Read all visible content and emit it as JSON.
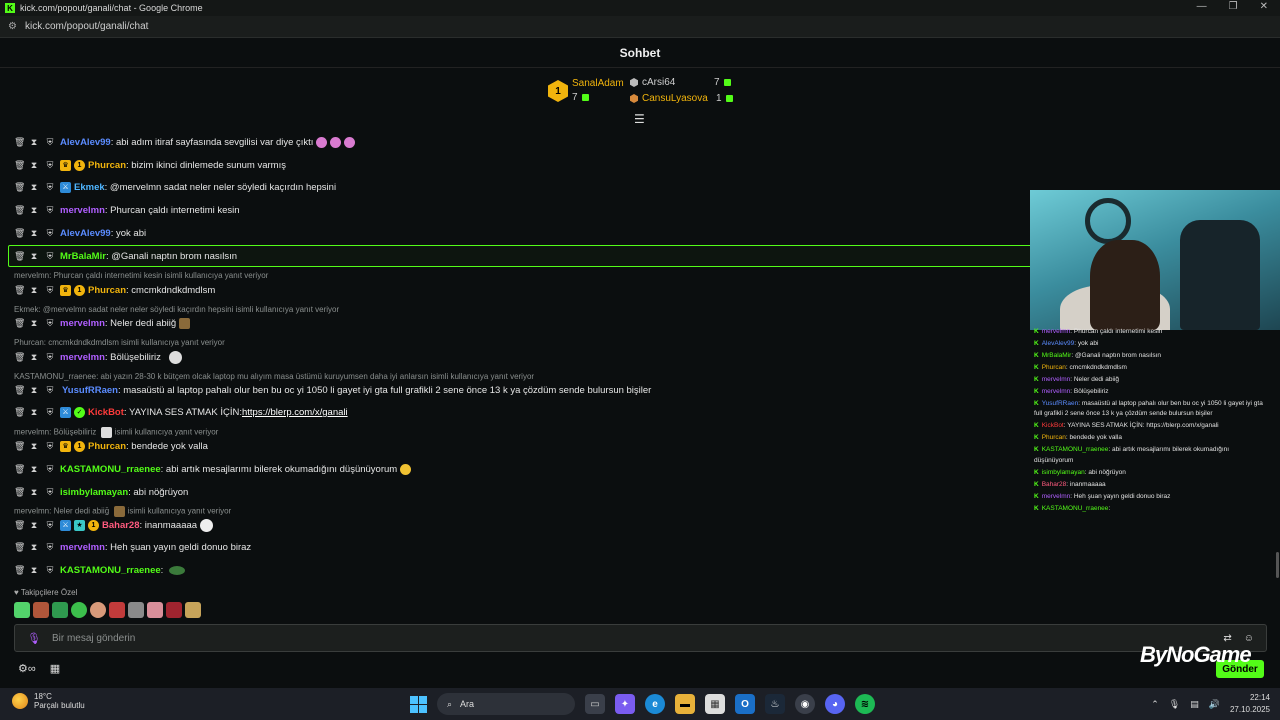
{
  "browser": {
    "window_title": "kick.com/popout/ganali/chat - Google Chrome",
    "url": "kick.com/popout/ganali/chat",
    "controls": [
      "—",
      "❐",
      "✕"
    ]
  },
  "chat": {
    "title": "Sohbet",
    "leaderboard": {
      "first": {
        "rank": "1",
        "name": "SanalAdam",
        "count": "7"
      },
      "second": {
        "name": "cArsi64",
        "count": "7"
      },
      "third": {
        "name": "CansuLyasova",
        "count": "1"
      }
    },
    "messages": [
      {
        "user": "AlevAlev99",
        "color": "#5b8cff",
        "text": ": abi adım itiraf sayfasında sevgilisi var diye çıktı"
      },
      {
        "user": "Phurcan",
        "color": "#f1b40d",
        "text": ": bizim ikinci dinlemede sunum varmış"
      },
      {
        "user": "Ekmek",
        "color": "#4fb5ff",
        "text": ": @mervelmn sadat neler neler söyledi kaçırdın hepsini"
      },
      {
        "user": "mervelmn",
        "color": "#b05fff",
        "text": ": Phurcan çaldı internetimi kesin"
      },
      {
        "user": "AlevAlev99",
        "color": "#5b8cff",
        "text": ": yok abi"
      },
      {
        "user": "MrBalaMir",
        "color": "#53fc18",
        "text": ": @Ganali naptın brom nasılsın"
      },
      {
        "user": "Phurcan",
        "color": "#f1b40d",
        "text": ": cmcmkdndkdmdlsm"
      },
      {
        "user": "mervelmn",
        "color": "#b05fff",
        "text": ": Neler dedi abiiğ"
      },
      {
        "user": "mervelmn",
        "color": "#b05fff",
        "text": ": Bölüşebiliriz"
      },
      {
        "user": "YusufRRaen",
        "color": "#5b8cff",
        "text": ": masaüstü al laptop pahalı olur ben bu oc yi 1050 li gayet iyi gta full grafikli 2 sene önce 13 k ya çözdüm sende bulursun bişiler"
      },
      {
        "user": "KickBot",
        "color": "#ff3b3b",
        "text": ": YAYINA SES ATMAK İÇİN: ",
        "link": "https://blerp.com/x/ganali"
      },
      {
        "user": "Phurcan",
        "color": "#f1b40d",
        "text": ": bendede yok valla"
      },
      {
        "user": "KASTAMONU_rraenee",
        "color": "#53fc18",
        "text": ": abi artık mesajlarımı bilerek okumadığını düşünüyorum"
      },
      {
        "user": "isimbylamayan",
        "color": "#53fc18",
        "text": ": abi nöğrüyon"
      },
      {
        "user": "Bahar28",
        "color": "#ff5b7f",
        "text": ": inanmaaaaa"
      },
      {
        "user": "mervelmn",
        "color": "#b05fff",
        "text": ": Heh şuan yayın geldi donuo biraz"
      },
      {
        "user": "KASTAMONU_rraenee",
        "color": "#53fc18",
        "text": ":"
      }
    ],
    "replies": [
      "mervelmn: Phurcan çaldı internetimi kesin isimli kullanıcıya yanıt veriyor",
      "Ekmek: @mervelmn sadat neler neler söyledi kaçırdın hepsini isimli kullanıcıya yanıt veriyor",
      "Phurcan: cmcmkdndkdmdlsm isimli kullanıcıya yanıt veriyor",
      "KASTAMONU_rraenee: abi yazın 28-30 k bütçem olcak laptop mu alıyım masa üstümü kuruyumsen daha iyi anlarsın isimli kullanıcıya yanıt veriyor",
      "mervelmn: Bölüşebiliriz",
      "isimli kullanıcıya yanıt veriyor",
      "mervelmn: Neler dedi abiiğ",
      "isimli kullanıcıya yanıt veriyor"
    ],
    "followers_label": "Takipçilere Özel",
    "input_placeholder": "Bir mesaj gönderin",
    "send_label": "Gönder"
  },
  "overlay": {
    "watermark": "ByNoGame",
    "mini_chat": [
      {
        "user": "mervelmn",
        "text": ": Phurcan çaldı internetimi kesin"
      },
      {
        "user": "AlevAlev99",
        "text": ": yok abi"
      },
      {
        "user": "MrBalaMir",
        "text": ": @Ganali naptın brom nasılsın"
      },
      {
        "user": "Phurcan",
        "text": ": cmcmkdndkdmdlsm"
      },
      {
        "user": "mervelmn",
        "text": ": Neler dedi abiiğ"
      },
      {
        "user": "mervelmn",
        "text": ": Bölüşebiliriz"
      },
      {
        "user": "YusufRRaen",
        "text": ": masaüstü al laptop pahalı olur ben bu oc yi 1050 li gayet iyi gta"
      },
      {
        "user": "",
        "text": "full grafikli 2 sene önce 13 k ya çözdüm sende bulursun bişiler"
      },
      {
        "user": "KickBot",
        "text": ": YAYINA SES ATMAK İÇİN: https://blerp.com/x/ganali"
      },
      {
        "user": "Phurcan",
        "text": ": bendede yok valla"
      },
      {
        "user": "KASTAMONU_rraenee",
        "text": ": abi artık mesajlarımı bilerek okumadığını"
      },
      {
        "user": "",
        "text": "düşünüyorum"
      },
      {
        "user": "isimbylamayan",
        "text": ": abi nöğrüyon"
      },
      {
        "user": "Bahar28",
        "text": ": inanmaaaaa"
      },
      {
        "user": "mervelmn",
        "text": ": Heh şuan yayın geldi donuo biraz"
      },
      {
        "user": "KASTAMONU_rraenee",
        "text": ":"
      }
    ]
  },
  "taskbar": {
    "weather_temp": "18°C",
    "weather_desc": "Parçalı bulutlu",
    "search_placeholder": "Ara",
    "time": "22:14",
    "date": "27.10.2025"
  },
  "colors": {
    "accent": "#53fc18",
    "gold": "#f1b40d",
    "background": "#0b0e0f"
  }
}
